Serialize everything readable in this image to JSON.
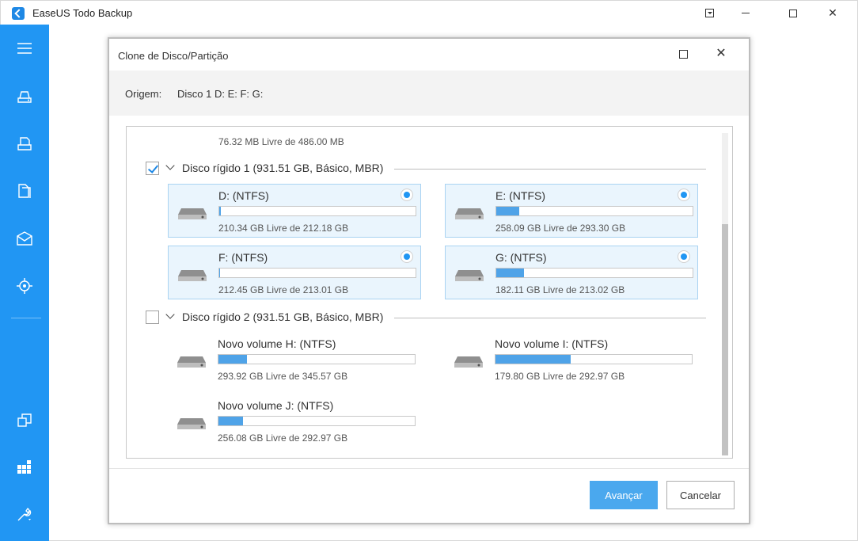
{
  "app": {
    "title": "EaseUS Todo Backup"
  },
  "window_controls": [
    "menu-dropdown",
    "minimize",
    "maximize",
    "close"
  ],
  "sidebar": {
    "icons": [
      "menu-icon",
      "disk-backup-icon",
      "system-backup-icon",
      "file-backup-icon",
      "mail-backup-icon",
      "smart-backup-icon",
      "clone-icon",
      "tools-grid-icon",
      "wrench-icon"
    ]
  },
  "dialog": {
    "title": "Clone de Disco/Partição",
    "origin_label": "Origem:",
    "origin_value": "Disco 1 D: E: F: G:",
    "previous_free": "76.32 MB Livre de 486.00 MB",
    "disks": [
      {
        "title": "Disco rígido 1 (931.51 GB, Básico, MBR)",
        "checked": true,
        "partitions": [
          {
            "name": "D: (NTFS)",
            "free": "210.34 GB Livre de 212.18 GB",
            "used_fraction": 0.009,
            "selected": true
          },
          {
            "name": "E: (NTFS)",
            "free": "258.09 GB Livre de 293.30 GB",
            "used_fraction": 0.12,
            "selected": true
          },
          {
            "name": "F: (NTFS)",
            "free": "212.45 GB Livre de 213.01 GB",
            "used_fraction": 0.003,
            "selected": true
          },
          {
            "name": "G: (NTFS)",
            "free": "182.11 GB Livre de 213.02 GB",
            "used_fraction": 0.145,
            "selected": true
          }
        ]
      },
      {
        "title": "Disco rígido 2 (931.51 GB, Básico, MBR)",
        "checked": false,
        "partitions": [
          {
            "name": "Novo volume H: (NTFS)",
            "free": "293.92 GB Livre de 345.57 GB",
            "used_fraction": 0.149,
            "selected": false
          },
          {
            "name": "Novo volume I: (NTFS)",
            "free": "179.80 GB Livre de 292.97 GB",
            "used_fraction": 0.386,
            "selected": false
          },
          {
            "name": "Novo volume J: (NTFS)",
            "free": "256.08 GB Livre de 292.97 GB",
            "used_fraction": 0.126,
            "selected": false
          }
        ]
      }
    ],
    "next_label": "Avançar",
    "cancel_label": "Cancelar"
  },
  "colors": {
    "accent": "#2196f3",
    "selection_bg": "#eaf5fd",
    "bar_fill": "#4fa3e8"
  }
}
